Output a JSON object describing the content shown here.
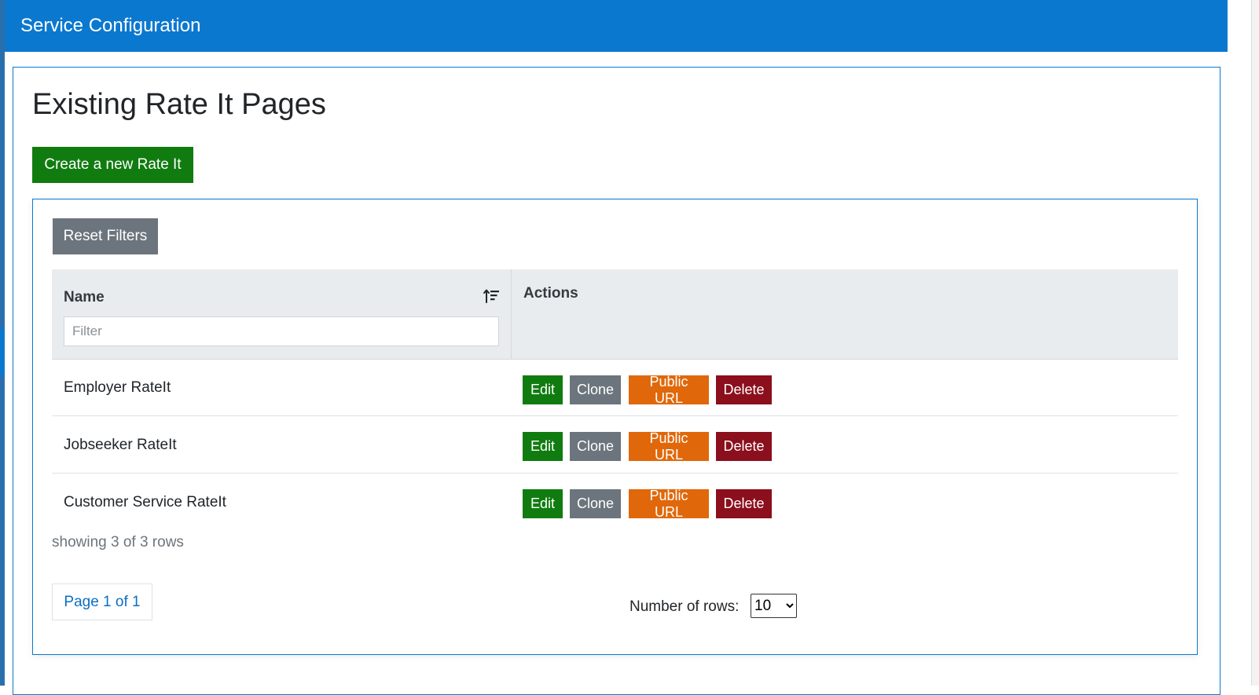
{
  "app": {
    "title": "Service Configuration"
  },
  "page": {
    "title": "Existing Rate It Pages",
    "create_label": "Create a new Rate It"
  },
  "table": {
    "reset_label": "Reset Filters",
    "columns": {
      "name": "Name",
      "actions": "Actions"
    },
    "filter_placeholder": "Filter",
    "sort_icon": "sort-descending-icon",
    "action_labels": {
      "edit": "Edit",
      "clone": "Clone",
      "public_url": "Public URL",
      "delete": "Delete"
    },
    "rows": [
      {
        "name": "Employer RateIt"
      },
      {
        "name": "Jobseeker RateIt"
      },
      {
        "name": "Customer Service RateIt"
      }
    ],
    "showing_text": "showing 3 of 3 rows"
  },
  "pagination": {
    "page_label": "Page 1 of 1",
    "rows_label": "Number of rows:",
    "rows_selected": "10"
  },
  "colors": {
    "topbar": "#0b78d0",
    "edit": "#107c10",
    "clone": "#6c757d",
    "public_url": "#e0680a",
    "delete": "#8b0f1c"
  }
}
